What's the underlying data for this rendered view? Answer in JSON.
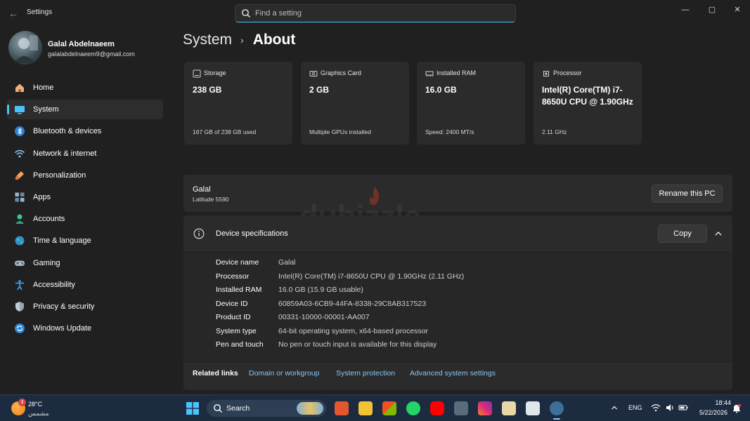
{
  "window": {
    "title": "Settings",
    "controls": {
      "minimize": "—",
      "maximize": "▢",
      "close": "✕"
    }
  },
  "search": {
    "placeholder": "Find a setting"
  },
  "profile": {
    "name": "Galal Abdelnaeem",
    "email": "galalabdelnaeem9@gmail.com"
  },
  "sidebar": {
    "items": [
      {
        "label": "Home",
        "icon": "home-icon"
      },
      {
        "label": "System",
        "icon": "system-icon",
        "active": true
      },
      {
        "label": "Bluetooth & devices",
        "icon": "bluetooth-icon"
      },
      {
        "label": "Network & internet",
        "icon": "wifi-icon"
      },
      {
        "label": "Personalization",
        "icon": "brush-icon"
      },
      {
        "label": "Apps",
        "icon": "apps-icon"
      },
      {
        "label": "Accounts",
        "icon": "accounts-icon"
      },
      {
        "label": "Time & language",
        "icon": "globe-icon"
      },
      {
        "label": "Gaming",
        "icon": "gamepad-icon"
      },
      {
        "label": "Accessibility",
        "icon": "accessibility-icon"
      },
      {
        "label": "Privacy & security",
        "icon": "shield-icon"
      },
      {
        "label": "Windows Update",
        "icon": "update-icon"
      }
    ]
  },
  "breadcrumb": {
    "parent": "System",
    "separator": "›",
    "current": "About"
  },
  "cards": [
    {
      "title": "Storage",
      "value": "238 GB",
      "sub": "167 GB of 238 GB used",
      "icon": "storage-icon"
    },
    {
      "title": "Graphics Card",
      "value": "2 GB",
      "sub": "Multiple GPUs installed",
      "icon": "graphics-card-icon"
    },
    {
      "title": "Installed RAM",
      "value": "16.0 GB",
      "sub": "Speed: 2400 MT/s",
      "icon": "ram-icon"
    },
    {
      "title": "Processor",
      "value": "Intel(R) Core(TM) i7-8650U CPU @ 1.90GHz",
      "sub": "2.11 GHz",
      "icon": "processor-icon"
    }
  ],
  "pc": {
    "name": "Galal",
    "model": "Latitude 5590",
    "rename_label": "Rename this PC"
  },
  "device_specs": {
    "title": "Device specifications",
    "copy_label": "Copy",
    "rows": [
      {
        "key": "Device name",
        "value": "Galal"
      },
      {
        "key": "Processor",
        "value": "Intel(R) Core(TM) i7-8650U CPU @ 1.90GHz (2.11 GHz)"
      },
      {
        "key": "Installed RAM",
        "value": "16.0 GB (15.9 GB usable)"
      },
      {
        "key": "Device ID",
        "value": "60859A03-6CB9-44FA-8338-29C8AB317523"
      },
      {
        "key": "Product ID",
        "value": "00331-10000-00001-AA007"
      },
      {
        "key": "System type",
        "value": "64-bit operating system, x64-based processor"
      },
      {
        "key": "Pen and touch",
        "value": "No pen or touch input is available for this display"
      }
    ]
  },
  "related_links": {
    "title": "Related links",
    "links": [
      "Domain or workgroup",
      "System protection",
      "Advanced system settings"
    ]
  },
  "watermark": {
    "text": "dubizzle"
  },
  "taskbar": {
    "weather": {
      "temp": "28°C",
      "desc": "مشمس",
      "badge": "3"
    },
    "search_label": "Search",
    "apps": [
      "brave-icon",
      "file-explorer-icon",
      "store-icon",
      "whatsapp-icon",
      "youtube-icon",
      "calculator-icon",
      "instagram-icon",
      "paint-icon",
      "app-icon",
      "settings-icon"
    ],
    "language": "ENG",
    "time": "18:44",
    "date": "5/22/2026"
  },
  "colors": {
    "accent": "#4cc2ff",
    "link": "#86c7f5",
    "bg": "#202020",
    "card": "#2b2b2b",
    "taskbar": "#1c2b40"
  }
}
